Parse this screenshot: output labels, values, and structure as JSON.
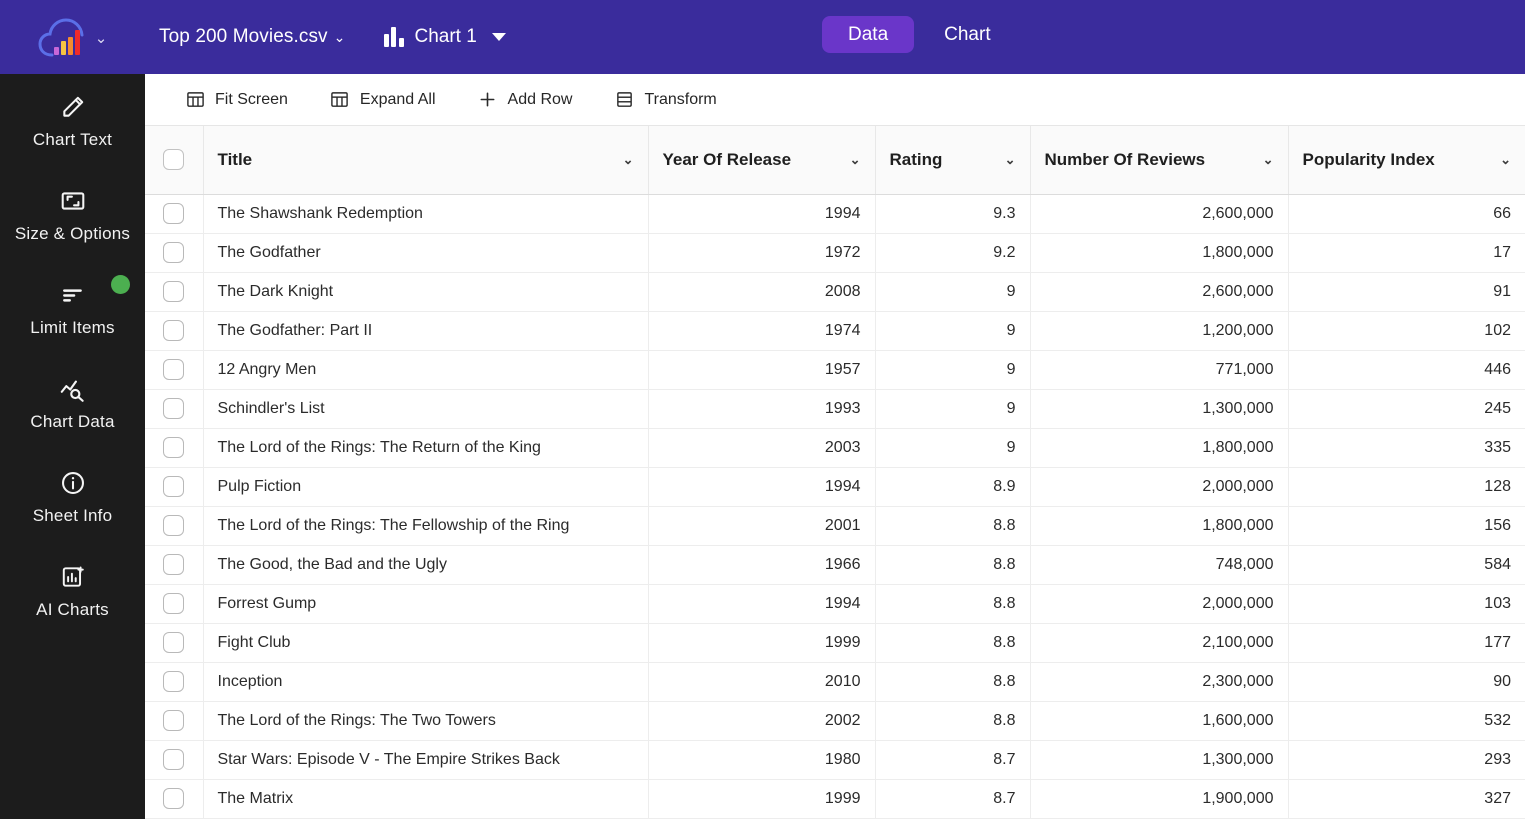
{
  "app": {
    "brand_icon": "cloud-bars-logo",
    "brand_caret": "⌄",
    "file_name": "Top 200 Movies.csv",
    "file_caret": "⌄",
    "chart_name": "Chart 1",
    "chart_icon": "bar-chart-icon",
    "header_color": "#3a2c9c",
    "active_tab_color": "#6a36c9"
  },
  "tabs": [
    {
      "label": "Data",
      "active": true
    },
    {
      "label": "Chart",
      "active": false
    }
  ],
  "sidebar": {
    "background": "#1c1c1c",
    "items": [
      {
        "label": "Chart Text",
        "icon": "pencil-icon",
        "badge": false
      },
      {
        "label": "Size & Options",
        "icon": "resize-frame-icon",
        "badge": false
      },
      {
        "label": "Limit Items",
        "icon": "filter-lines-icon",
        "badge": true,
        "badge_color": "#4caf50"
      },
      {
        "label": "Chart Data",
        "icon": "chart-search-icon",
        "badge": false
      },
      {
        "label": "Sheet Info",
        "icon": "info-circle-icon",
        "badge": false
      },
      {
        "label": "AI Charts",
        "icon": "chart-plus-icon",
        "badge": false
      }
    ]
  },
  "toolbar": {
    "buttons": [
      {
        "label": "Fit Screen",
        "icon": "table-columns-icon"
      },
      {
        "label": "Expand All",
        "icon": "table-columns-icon"
      },
      {
        "label": "Add Row",
        "icon": "plus-icon"
      },
      {
        "label": "Transform",
        "icon": "table-rows-icon"
      }
    ]
  },
  "table": {
    "select_all_checkbox": false,
    "columns": [
      {
        "label": "Title",
        "align": "left",
        "caret": "⌄"
      },
      {
        "label": "Year Of Release",
        "align": "right",
        "caret": "⌄"
      },
      {
        "label": "Rating",
        "align": "right",
        "caret": "⌄"
      },
      {
        "label": "Number Of Reviews",
        "align": "right",
        "caret": "⌄"
      },
      {
        "label": "Popularity Index",
        "align": "right",
        "caret": "⌄"
      }
    ],
    "rows": [
      {
        "title": "The Shawshank Redemption",
        "year": "1994",
        "rating": "9.3",
        "reviews": "2,600,000",
        "popularity": "66"
      },
      {
        "title": "The Godfather",
        "year": "1972",
        "rating": "9.2",
        "reviews": "1,800,000",
        "popularity": "17"
      },
      {
        "title": "The Dark Knight",
        "year": "2008",
        "rating": "9",
        "reviews": "2,600,000",
        "popularity": "91"
      },
      {
        "title": "The Godfather: Part II",
        "year": "1974",
        "rating": "9",
        "reviews": "1,200,000",
        "popularity": "102"
      },
      {
        "title": "12 Angry Men",
        "year": "1957",
        "rating": "9",
        "reviews": "771,000",
        "popularity": "446"
      },
      {
        "title": "Schindler's List",
        "year": "1993",
        "rating": "9",
        "reviews": "1,300,000",
        "popularity": "245"
      },
      {
        "title": "The Lord of the Rings: The Return of the King",
        "year": "2003",
        "rating": "9",
        "reviews": "1,800,000",
        "popularity": "335"
      },
      {
        "title": "Pulp Fiction",
        "year": "1994",
        "rating": "8.9",
        "reviews": "2,000,000",
        "popularity": "128"
      },
      {
        "title": "The Lord of the Rings: The Fellowship of the Ring",
        "year": "2001",
        "rating": "8.8",
        "reviews": "1,800,000",
        "popularity": "156"
      },
      {
        "title": "The Good, the Bad and the Ugly",
        "year": "1966",
        "rating": "8.8",
        "reviews": "748,000",
        "popularity": "584"
      },
      {
        "title": "Forrest Gump",
        "year": "1994",
        "rating": "8.8",
        "reviews": "2,000,000",
        "popularity": "103"
      },
      {
        "title": "Fight Club",
        "year": "1999",
        "rating": "8.8",
        "reviews": "2,100,000",
        "popularity": "177"
      },
      {
        "title": "Inception",
        "year": "2010",
        "rating": "8.8",
        "reviews": "2,300,000",
        "popularity": "90"
      },
      {
        "title": "The Lord of the Rings: The Two Towers",
        "year": "2002",
        "rating": "8.8",
        "reviews": "1,600,000",
        "popularity": "532"
      },
      {
        "title": "Star Wars: Episode V - The Empire Strikes Back",
        "year": "1980",
        "rating": "8.7",
        "reviews": "1,300,000",
        "popularity": "293"
      },
      {
        "title": "The Matrix",
        "year": "1999",
        "rating": "8.7",
        "reviews": "1,900,000",
        "popularity": "327"
      }
    ]
  }
}
